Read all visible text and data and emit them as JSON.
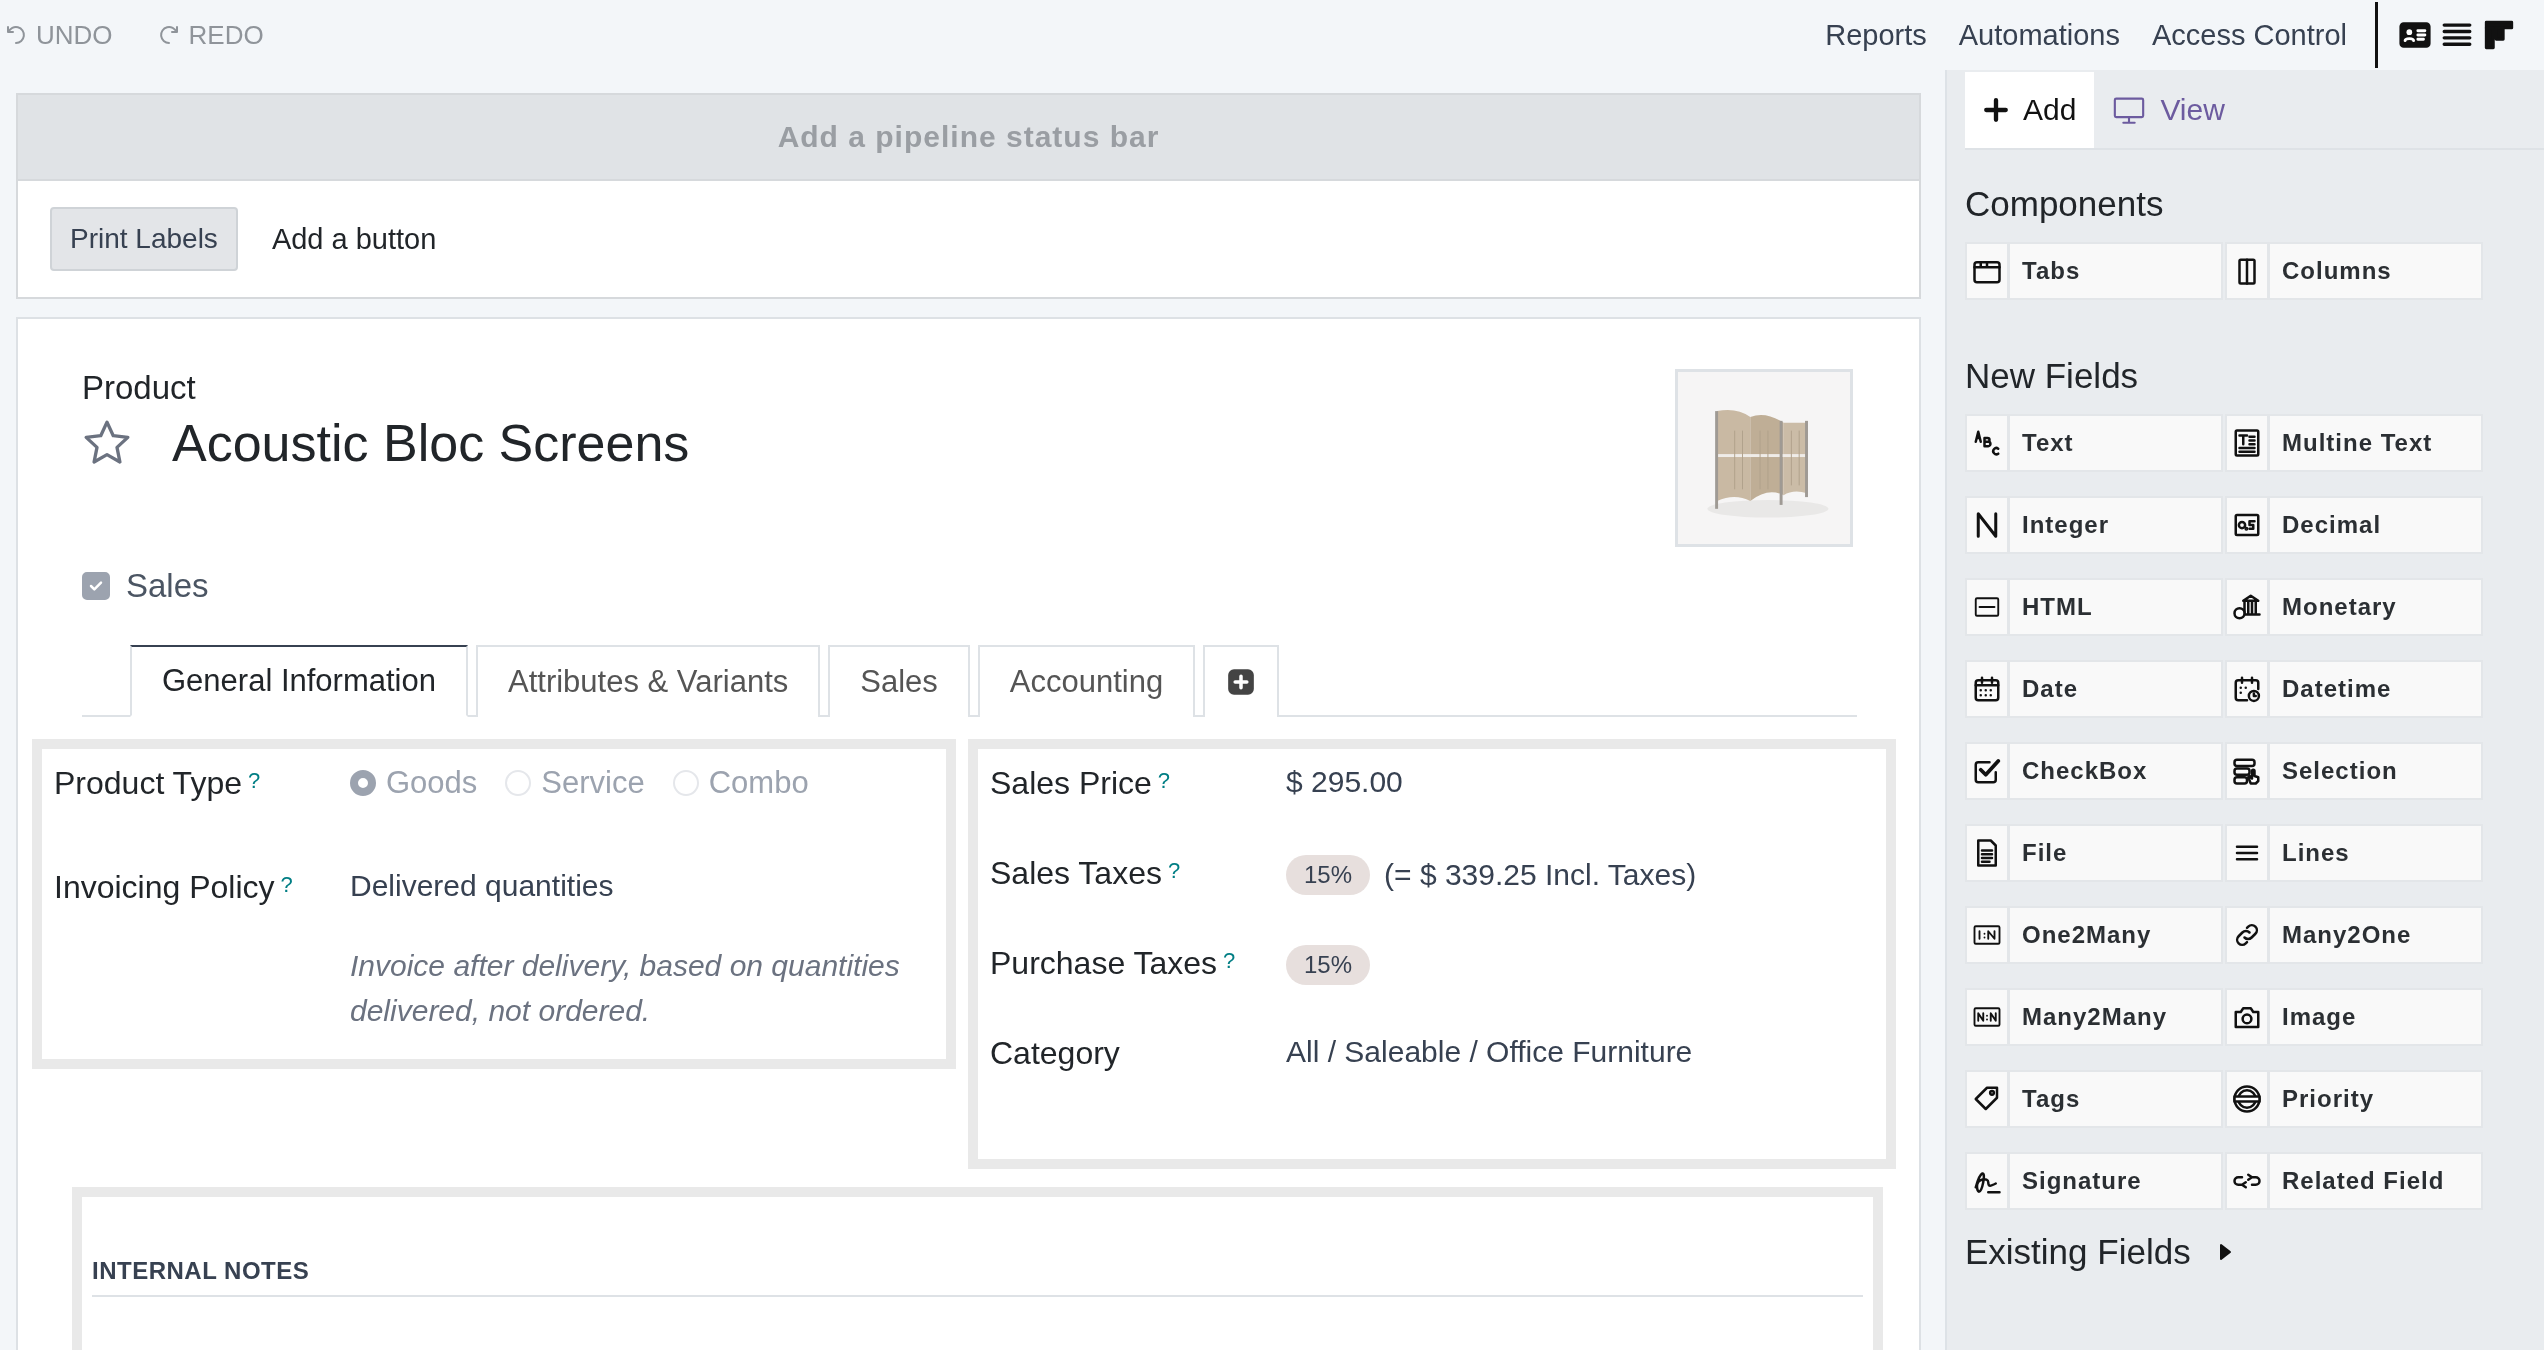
{
  "toolbar": {
    "undo": "UNDO",
    "redo": "REDO",
    "menu": [
      {
        "label": "Reports"
      },
      {
        "label": "Automations"
      },
      {
        "label": "Access Control"
      }
    ],
    "view_switches": [
      {
        "kind": "form",
        "selected": false
      },
      {
        "kind": "list",
        "selected": false
      },
      {
        "kind": "kanban",
        "selected": false
      }
    ]
  },
  "status_bar_placeholder": "Add a pipeline status bar",
  "header_buttons": [
    {
      "label": "Print Labels",
      "kind": "button"
    },
    {
      "label": "Add a button",
      "kind": "link"
    }
  ],
  "form": {
    "model": "Product",
    "title": "Acoustic Bloc Screens",
    "favorite": false,
    "sales_checkbox": {
      "label": "Sales",
      "checked": true
    },
    "tabs": [
      {
        "kind": "text",
        "label": "General Information",
        "selected": true
      },
      {
        "kind": "text",
        "label": "Attributes & Variants",
        "selected": false
      },
      {
        "kind": "text",
        "label": "Sales",
        "selected": false
      },
      {
        "kind": "text",
        "label": "Accounting",
        "selected": false
      },
      {
        "kind": "add",
        "selected": false
      }
    ],
    "left_group": [
      {
        "kind": "radio",
        "label": "Product Type",
        "help": "?",
        "options": [
          {
            "label": "Goods",
            "selected": true
          },
          {
            "label": "Service",
            "selected": false
          },
          {
            "label": "Combo",
            "selected": false
          }
        ]
      },
      {
        "kind": "text",
        "label": "Invoicing Policy",
        "help": "?",
        "value": "Delivered quantities",
        "note": "Invoice after delivery, based on quantities delivered, not ordered."
      }
    ],
    "right_group": [
      {
        "kind": "text",
        "label": "Sales Price",
        "help": "?",
        "value": "$ 295.00"
      },
      {
        "kind": "tags",
        "label": "Sales Taxes",
        "help": "?",
        "tags": [
          "15%"
        ],
        "suffix": "(= $ 339.25 Incl. Taxes)"
      },
      {
        "kind": "tags",
        "label": "Purchase Taxes",
        "help": "?",
        "tags": [
          "15%"
        ]
      },
      {
        "kind": "text",
        "label": "Category",
        "value": "All / Saleable / Office Furniture"
      }
    ],
    "internal_notes": "INTERNAL NOTES"
  },
  "sidebar": {
    "tabs": [
      {
        "kind": "add",
        "label": "Add",
        "selected": true
      },
      {
        "kind": "view",
        "label": "View",
        "selected": false
      }
    ],
    "sections": [
      {
        "title": "Components",
        "items": [
          {
            "kind": "tabs",
            "label": "Tabs"
          },
          {
            "kind": "columns",
            "label": "Columns"
          }
        ]
      },
      {
        "title": "New Fields",
        "items": [
          {
            "kind": "char",
            "label": "Text"
          },
          {
            "kind": "text",
            "label": "Multine Text"
          },
          {
            "kind": "integer",
            "label": "Integer"
          },
          {
            "kind": "float",
            "label": "Decimal"
          },
          {
            "kind": "html",
            "label": "HTML"
          },
          {
            "kind": "monetary",
            "label": "Monetary"
          },
          {
            "kind": "date",
            "label": "Date"
          },
          {
            "kind": "datetime",
            "label": "Datetime"
          },
          {
            "kind": "boolean",
            "label": "CheckBox"
          },
          {
            "kind": "selection",
            "label": "Selection"
          },
          {
            "kind": "binary",
            "label": "File"
          },
          {
            "kind": "lines",
            "label": "Lines"
          },
          {
            "kind": "one2many",
            "label": "One2Many"
          },
          {
            "kind": "many2one",
            "label": "Many2One"
          },
          {
            "kind": "many2many",
            "label": "Many2Many"
          },
          {
            "label": "Image"
          },
          {
            "kind": "tags",
            "label": "Tags"
          },
          {
            "kind": "priority",
            "label": "Priority"
          },
          {
            "kind": "signature",
            "label": "Signature"
          },
          {
            "kind": "related",
            "label": "Related Field"
          }
        ]
      }
    ],
    "existing_fields": {
      "label": "Existing Fields",
      "expanded": false
    }
  }
}
